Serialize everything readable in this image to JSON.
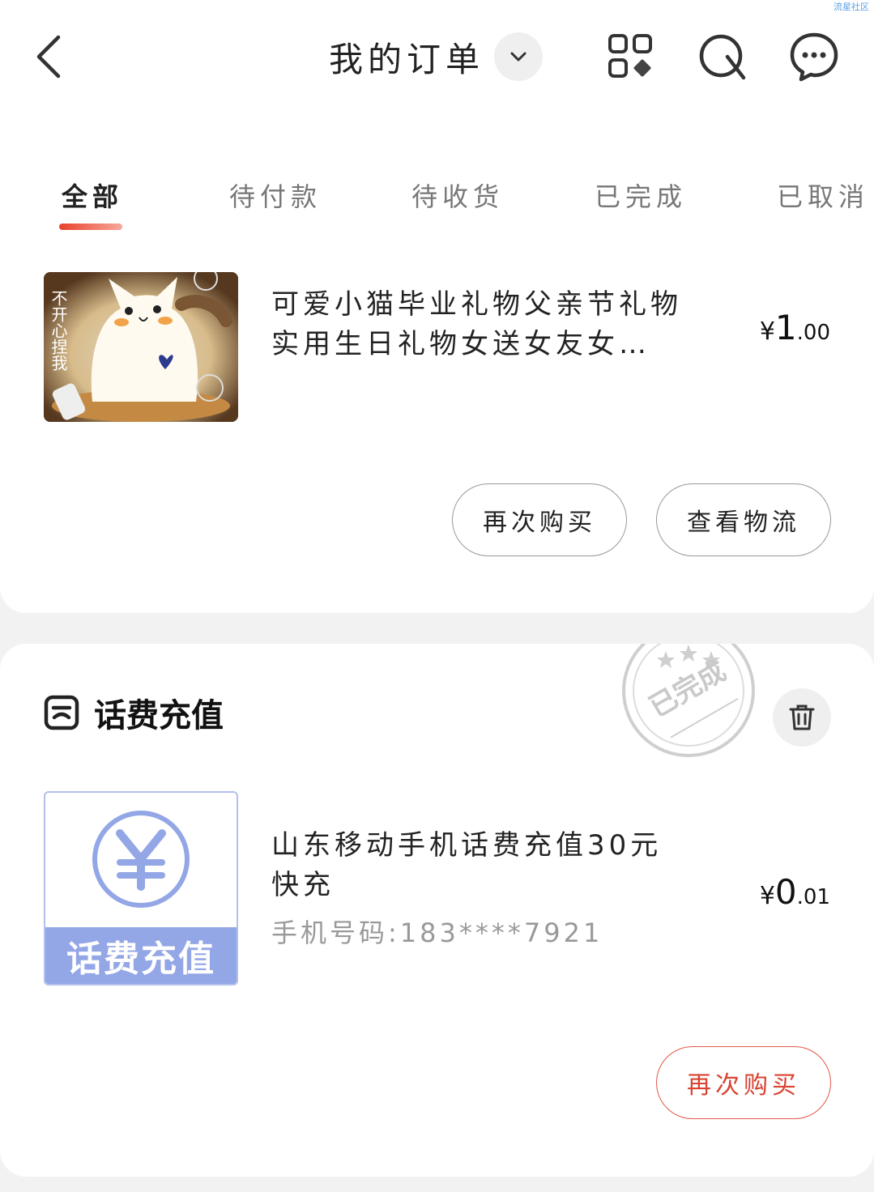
{
  "watermark": "流星社区",
  "header": {
    "title": "我的订单",
    "icons": [
      "back-arrow-icon",
      "chevron-down-icon",
      "grid-apps-icon",
      "search-icon",
      "message-icon"
    ]
  },
  "tabs": [
    {
      "label": "全部",
      "active": true
    },
    {
      "label": "待付款",
      "active": false
    },
    {
      "label": "待收货",
      "active": false
    },
    {
      "label": "已完成",
      "active": false
    },
    {
      "label": "已取消",
      "active": false
    }
  ],
  "order1": {
    "thumb_text": "不开心捏我",
    "title_line1": "可爱小猫毕业礼物父亲节礼物",
    "title_line2": "实用生日礼物女送女友女…",
    "price_symbol": "¥",
    "price_int": "1",
    "price_dec": ".00",
    "btn_rebuy": "再次购买",
    "btn_logistics": "查看物流"
  },
  "order2": {
    "category": "话费充值",
    "stamp_text": "已完成",
    "thumb_label": "话费充值",
    "title_line1": "山东移动手机话费充值30元",
    "title_line2": "快充",
    "phone": "手机号码:183****7921",
    "price_symbol": "¥",
    "price_int": "0",
    "price_dec": ".01",
    "btn_rebuy": "再次购买"
  },
  "colors": {
    "accent": "#e8402e",
    "stamp": "#c9c9c9",
    "recharge": "#93a6e6"
  }
}
